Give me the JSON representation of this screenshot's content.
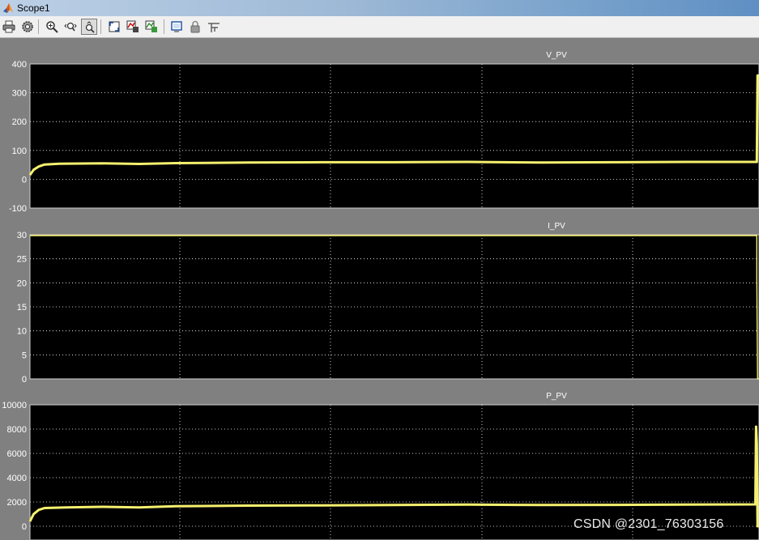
{
  "window": {
    "title": "Scope1",
    "icon": "matlab-logo-icon"
  },
  "toolbar": {
    "items": [
      {
        "name": "print-icon"
      },
      {
        "name": "parameters-gear-icon"
      },
      {
        "name": "zoom-in-icon"
      },
      {
        "name": "zoom-x-icon"
      },
      {
        "name": "zoom-y-icon",
        "active": true
      },
      {
        "name": "autoscale-icon"
      },
      {
        "name": "save-axes-settings-icon"
      },
      {
        "name": "restore-axes-settings-icon"
      },
      {
        "name": "floating-scope-icon"
      },
      {
        "name": "lock-axes-icon"
      },
      {
        "name": "signal-selection-icon"
      }
    ]
  },
  "colors": {
    "background": "#808080",
    "plot_background": "#000000",
    "grid": "#ffffff",
    "trace": "#f5f06e",
    "toolbar": "#f0f0f0"
  },
  "watermark": "CSDN @2301_76303156",
  "chart_data": [
    {
      "type": "line",
      "title": "V_PV",
      "ylim": [
        -100,
        400
      ],
      "yticks": [
        -100,
        0,
        100,
        200,
        300,
        400
      ],
      "xlim": [
        0,
        1
      ],
      "grid": true,
      "series": [
        {
          "values": [
            [
              0,
              15
            ],
            [
              0.005,
              33
            ],
            [
              0.012,
              44
            ],
            [
              0.02,
              51
            ],
            [
              0.04,
              54
            ],
            [
              0.1,
              55
            ],
            [
              0.15,
              53
            ],
            [
              0.2,
              56
            ],
            [
              0.3,
              58
            ],
            [
              0.4,
              59
            ],
            [
              0.5,
              59
            ],
            [
              0.6,
              60
            ],
            [
              0.7,
              58
            ],
            [
              0.8,
              59
            ],
            [
              0.9,
              60
            ],
            [
              0.997,
              60
            ],
            [
              0.998,
              360
            ],
            [
              1,
              360
            ]
          ]
        }
      ]
    },
    {
      "type": "line",
      "title": "I_PV",
      "ylim": [
        0,
        30
      ],
      "yticks": [
        0,
        5,
        10,
        15,
        20,
        25,
        30
      ],
      "xlim": [
        0,
        1
      ],
      "grid": true,
      "series": [
        {
          "values": [
            [
              0,
              30
            ],
            [
              0.997,
              30
            ],
            [
              0.997,
              21
            ],
            [
              0.998,
              0
            ],
            [
              1,
              0
            ]
          ]
        }
      ]
    },
    {
      "type": "line",
      "title": "P_PV",
      "ylim": [
        0,
        10000
      ],
      "yticks": [
        0,
        2000,
        4000,
        6000,
        8000,
        10000
      ],
      "xlim": [
        0,
        1
      ],
      "grid": true,
      "series": [
        {
          "values": [
            [
              0,
              400
            ],
            [
              0.005,
              1000
            ],
            [
              0.012,
              1350
            ],
            [
              0.02,
              1500
            ],
            [
              0.05,
              1550
            ],
            [
              0.1,
              1600
            ],
            [
              0.15,
              1550
            ],
            [
              0.2,
              1650
            ],
            [
              0.3,
              1700
            ],
            [
              0.4,
              1720
            ],
            [
              0.5,
              1750
            ],
            [
              0.6,
              1780
            ],
            [
              0.7,
              1750
            ],
            [
              0.8,
              1760
            ],
            [
              0.9,
              1780
            ],
            [
              0.995,
              1800
            ],
            [
              0.996,
              8200
            ],
            [
              0.997,
              6800
            ],
            [
              0.998,
              0
            ],
            [
              1,
              0
            ]
          ]
        }
      ]
    }
  ]
}
